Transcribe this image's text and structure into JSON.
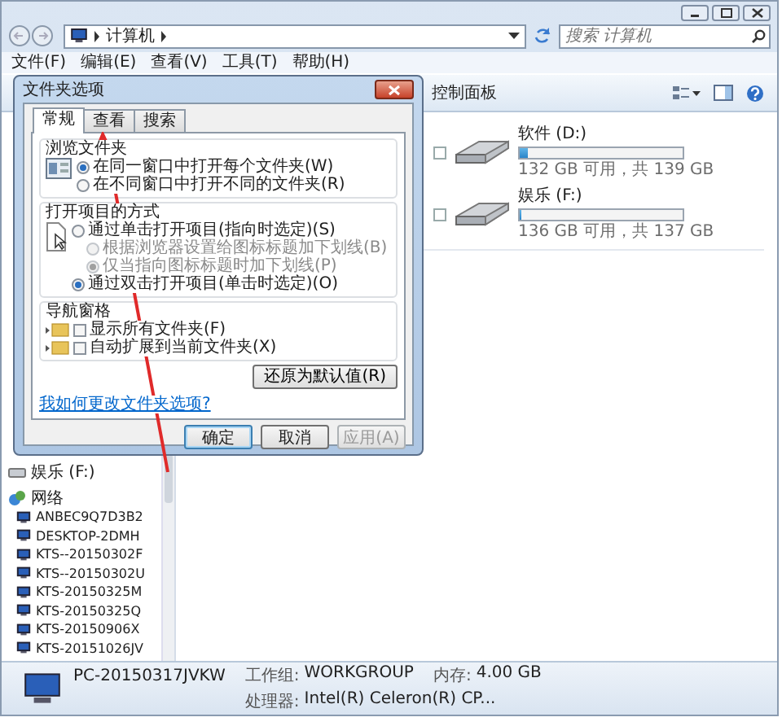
{
  "address_bar": {
    "path": "计算机"
  },
  "search": {
    "placeholder": "搜索 计算机"
  },
  "menu": [
    "文件(F)",
    "编辑(E)",
    "查看(V)",
    "工具(T)",
    "帮助(H)"
  ],
  "toolbar": {
    "items": [
      "控制面板"
    ]
  },
  "nav_pane": {
    "items": [
      {
        "kind": "drive",
        "label": "娱乐 (F:)"
      },
      {
        "kind": "network",
        "label": "网络",
        "children": [
          {
            "label": "ANBEC9Q7D3B2"
          },
          {
            "label": "DESKTOP-2DMH"
          },
          {
            "label": "KTS--20150302F"
          },
          {
            "label": "KTS--20150302U"
          },
          {
            "label": "KTS-20150325M"
          },
          {
            "label": "KTS-20150325Q"
          },
          {
            "label": "KTS-20150906X"
          },
          {
            "label": "KTS-20151026JV"
          }
        ]
      }
    ]
  },
  "drives": [
    {
      "name": "软件 (D:)",
      "checked": false,
      "level": 0.05,
      "reading": "132 GB 可用，共 139 GB"
    },
    {
      "name": "娱乐 (F:)",
      "checked": false,
      "level": 0.01,
      "reading": "136 GB 可用，共 137 GB"
    }
  ],
  "status_bar": {
    "computer_name": "PC-20150317JVKW",
    "fields": [
      {
        "label": "工作组:",
        "value": "WORKGROUP"
      },
      {
        "label": "内存:",
        "value": "4.00 GB"
      },
      {
        "label": "处理器:",
        "value": "Intel(R) Celeron(R) CP..."
      }
    ]
  },
  "dialog": {
    "title": "文件夹选项",
    "tabs": [
      {
        "label": "常规",
        "selected": true
      },
      {
        "label": "查看",
        "selected": false
      },
      {
        "label": "搜索",
        "selected": false
      }
    ],
    "groups": [
      {
        "title": "浏览文件夹",
        "kind": "radio",
        "options": [
          {
            "label": "在同一窗口中打开每个文件夹(W)",
            "selected": true
          },
          {
            "label": "在不同窗口中打开不同的文件夹(R)",
            "selected": false
          }
        ]
      },
      {
        "title": "打开项目的方式",
        "kind": "radio",
        "options": [
          {
            "label": "通过单击打开项目(指向时选定)(S)",
            "selected": false,
            "children": [
              {
                "label": "根据浏览器设置给图标标题加下划线(B)",
                "selected": false,
                "disabled": true
              },
              {
                "label": "仅当指向图标标题时加下划线(P)",
                "selected": true,
                "disabled": true
              }
            ]
          },
          {
            "label": "通过双击打开项目(单击时选定)(O)",
            "selected": true
          }
        ]
      },
      {
        "title": "导航窗格",
        "kind": "checkbox",
        "options": [
          {
            "label": "显示所有文件夹(F)",
            "checked": false
          },
          {
            "label": "自动扩展到当前文件夹(X)",
            "checked": false
          }
        ]
      }
    ],
    "restore_button": "还原为默认值(R)",
    "help_link": "我如何更改文件夹选项?",
    "buttons": [
      {
        "label": "确定",
        "disabled": false
      },
      {
        "label": "取消",
        "disabled": false
      },
      {
        "label": "应用(A)",
        "disabled": true
      }
    ]
  }
}
